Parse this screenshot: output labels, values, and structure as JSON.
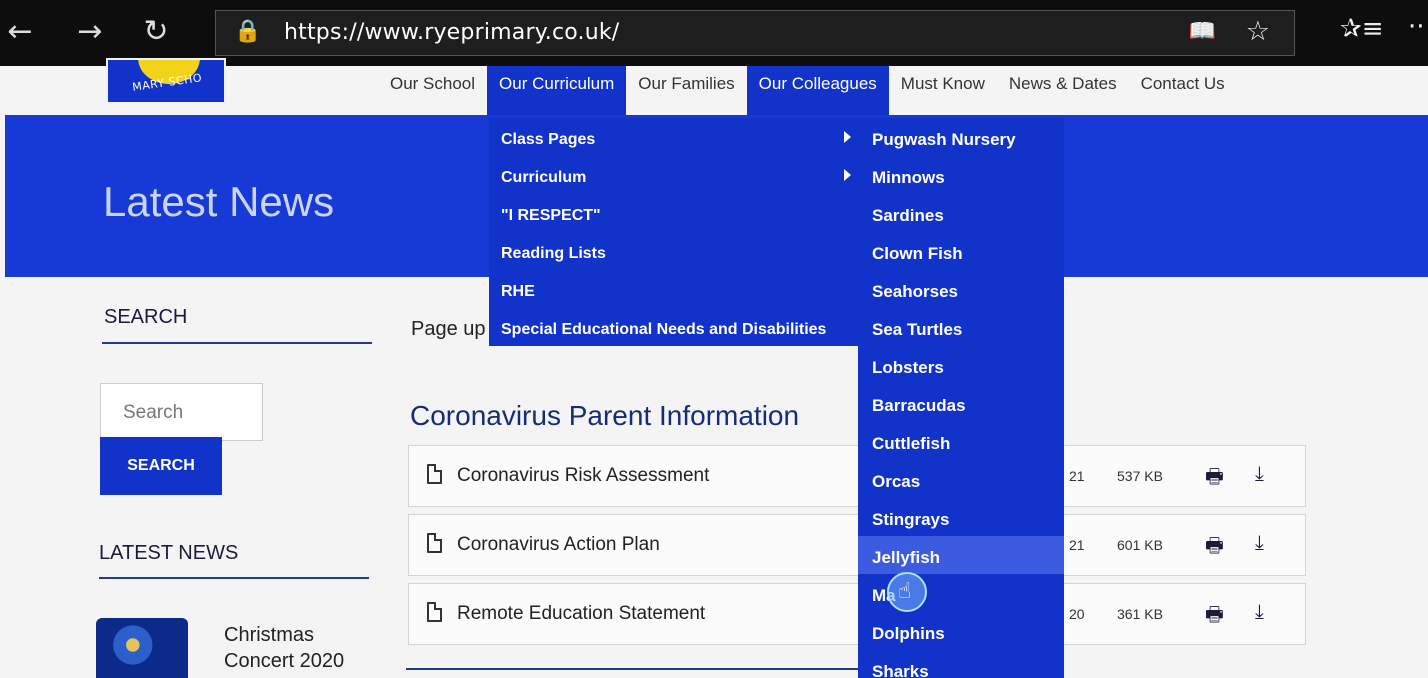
{
  "browser": {
    "url": "https://www.ryeprimary.co.uk/",
    "back_icon": "←",
    "forward_icon": "→",
    "refresh_icon": "↻",
    "lock_icon": "🔒",
    "reading_icon": "📖",
    "favorite_icon": "☆",
    "favorites_icon": "✰≡",
    "more_icon": "··"
  },
  "logo": {
    "text": "MARY SCHO"
  },
  "topnav": [
    "Our School",
    "Our Curriculum",
    "Our Families",
    "Our Colleagues",
    "Must Know",
    "News & Dates",
    "Contact Us"
  ],
  "banner": {
    "title": "Latest News"
  },
  "sidebar": {
    "search_heading": "SEARCH",
    "search_placeholder": "Search",
    "search_button": "SEARCH",
    "latest_heading": "LATEST NEWS",
    "news_item_title": "Christmas Concert 2020"
  },
  "main": {
    "page_updated_prefix": "Page up",
    "section_title": "Coronavirus Parent Information",
    "documents": [
      {
        "name": "Coronavirus Risk Assessment",
        "date_fragment": "21",
        "size": "537 KB"
      },
      {
        "name": "Coronavirus Action Plan",
        "date_fragment": "21",
        "size": "601 KB"
      },
      {
        "name": "Remote Education Statement",
        "date_fragment": "20",
        "size": "361 KB"
      }
    ],
    "print_icon": "🖶",
    "download_icon": "⤓"
  },
  "curriculum_menu": [
    "Class Pages",
    "Curriculum",
    "\"I RESPECT\"",
    "Reading Lists",
    "RHE",
    "Special Educational Needs and Disabilities"
  ],
  "class_pages_menu": [
    "Pugwash Nursery",
    "Minnows",
    "Sardines",
    "Clown Fish",
    "Seahorses",
    "Sea Turtles",
    "Lobsters",
    "Barracudas",
    "Cuttlefish",
    "Orcas",
    "Stingrays",
    "Jellyfish",
    "Ma",
    "Dolphins",
    "Sharks"
  ],
  "cursor_icon": "☝",
  "colors": {
    "brand_blue": "#1233c9",
    "banner_blue": "#1739d6",
    "hover_blue": "#3c5be0"
  }
}
